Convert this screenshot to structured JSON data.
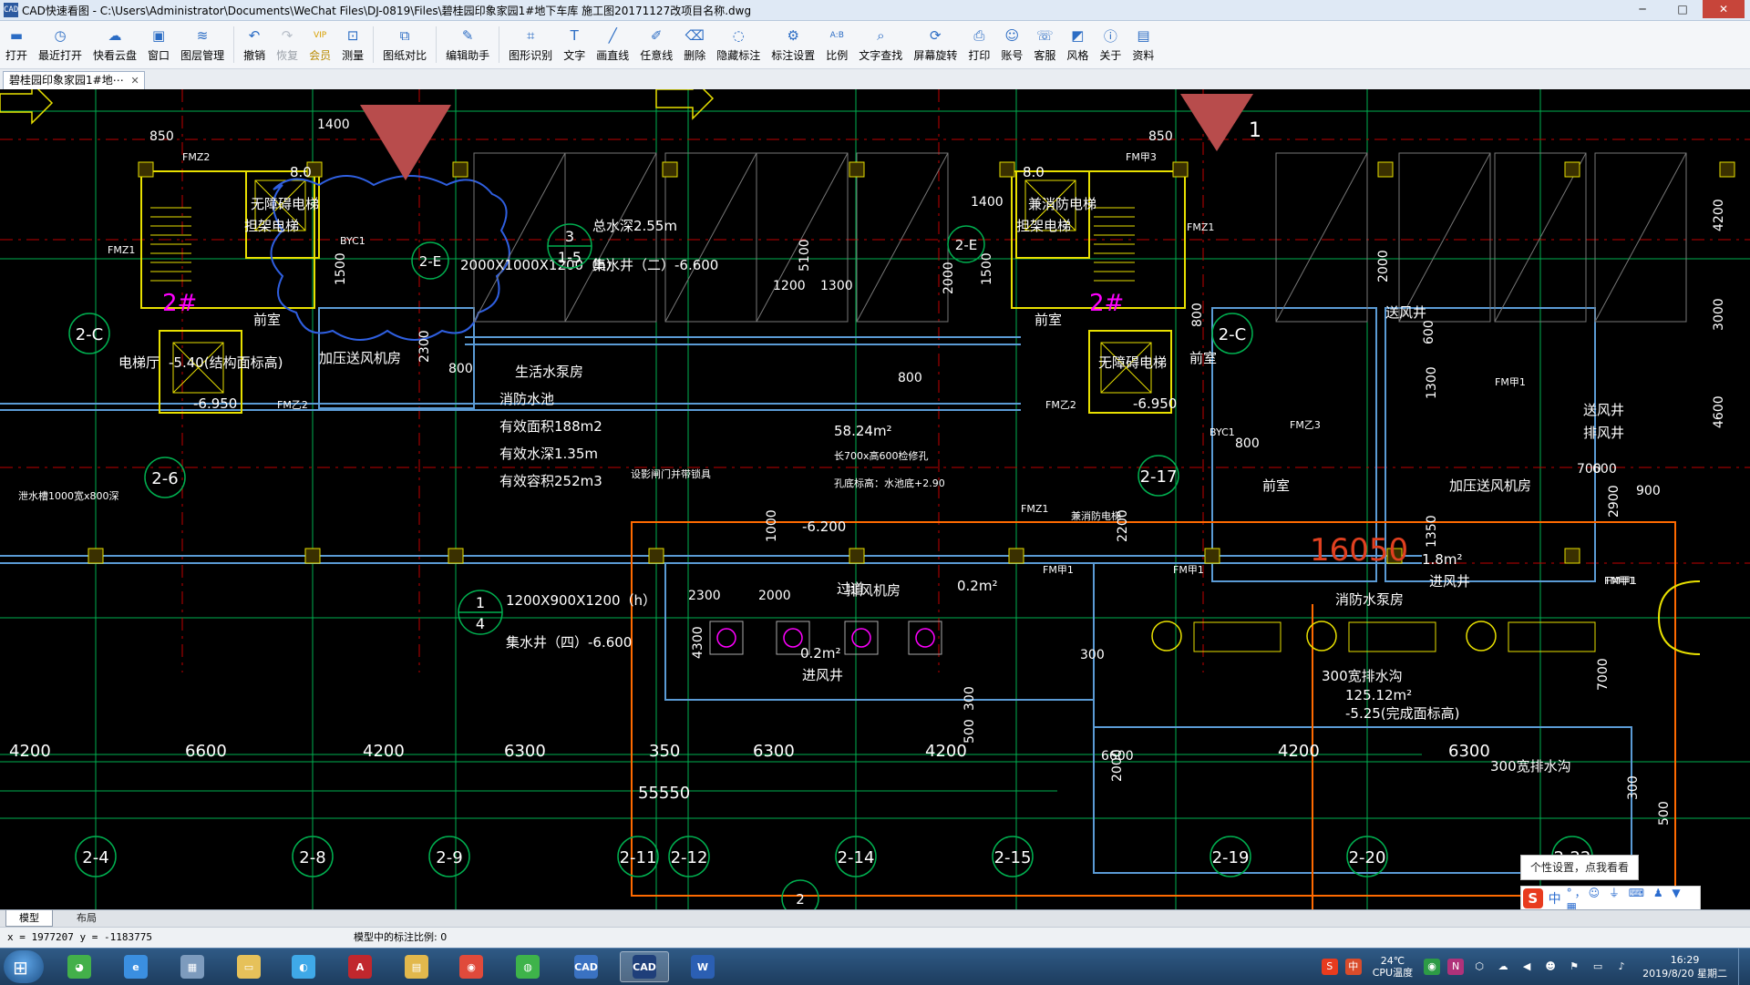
{
  "window": {
    "icon_text": "CAD",
    "title": "CAD快速看图 - C:\\Users\\Administrator\\Documents\\WeChat Files\\DJ-0819\\Files\\碧桂园印象家园1#地下车库 施工图20171127改项目名称.dwg",
    "minimize": "─",
    "maximize": "□",
    "close": "✕"
  },
  "toolbar": [
    {
      "label": "打开",
      "icon": "folder-open-icon",
      "glyph": "▬"
    },
    {
      "label": "最近打开",
      "icon": "clock-icon",
      "glyph": "◷"
    },
    {
      "label": "快看云盘",
      "icon": "cloud-icon",
      "glyph": "☁"
    },
    {
      "label": "窗口",
      "icon": "window-icon",
      "glyph": "▣"
    },
    {
      "label": "图层管理",
      "icon": "layers-icon",
      "glyph": "≋"
    },
    {
      "label": "撤销",
      "icon": "undo-icon",
      "glyph": "↶"
    },
    {
      "label": "恢复",
      "icon": "redo-icon",
      "glyph": "↷",
      "disabled": true
    },
    {
      "label": "会员",
      "icon": "vip-icon",
      "glyph": "VIP",
      "vip": true
    },
    {
      "label": "测量",
      "icon": "measure-icon",
      "glyph": "⊡"
    },
    {
      "label": "图纸对比",
      "icon": "compare-icon",
      "glyph": "⧉"
    },
    {
      "label": "编辑助手",
      "icon": "edit-assistant-icon",
      "glyph": "✎"
    },
    {
      "label": "图形识别",
      "icon": "shape-recognition-icon",
      "glyph": "⌗"
    },
    {
      "label": "文字",
      "icon": "text-icon",
      "glyph": "T"
    },
    {
      "label": "画直线",
      "icon": "line-icon",
      "glyph": "╱"
    },
    {
      "label": "任意线",
      "icon": "freehand-icon",
      "glyph": "✐"
    },
    {
      "label": "删除",
      "icon": "eraser-icon",
      "glyph": "⌫"
    },
    {
      "label": "隐藏标注",
      "icon": "hide-annotation-icon",
      "glyph": "◌"
    },
    {
      "label": "标注设置",
      "icon": "annotation-settings-icon",
      "glyph": "⚙"
    },
    {
      "label": "比例",
      "icon": "scale-icon",
      "glyph": "A:B"
    },
    {
      "label": "文字查找",
      "icon": "text-search-icon",
      "glyph": "⌕"
    },
    {
      "label": "屏幕旋转",
      "icon": "rotate-screen-icon",
      "glyph": "⟳"
    },
    {
      "label": "打印",
      "icon": "print-icon",
      "glyph": "⎙"
    },
    {
      "label": "账号",
      "icon": "account-icon",
      "glyph": "☺"
    },
    {
      "label": "客服",
      "icon": "headset-icon",
      "glyph": "☏"
    },
    {
      "label": "风格",
      "icon": "style-icon",
      "glyph": "◩"
    },
    {
      "label": "关于",
      "icon": "info-icon",
      "glyph": "ⓘ"
    },
    {
      "label": "资料",
      "icon": "documents-icon",
      "glyph": "▤"
    }
  ],
  "doc_tab": {
    "label": "碧桂园印象家园1#地⋯",
    "close": "✕"
  },
  "drawing": {
    "labels_white": [
      "电梯厅",
      "前室",
      "加压送风机房",
      "前室",
      "前室",
      "前室",
      "加压送风机房",
      "排风机房",
      "消防水泵房",
      "生活水泵房",
      "消防水池",
      "有效面积188m2",
      "有效水深1.35m",
      "有效容积252m3",
      "总水深2.55m",
      "集水井（二）-6.600",
      "1200X900X1200（h）",
      "集水井（四）-6.600",
      "2000X1000X1200（h）",
      "送风井",
      "送风井",
      "排风井",
      "1.8m²",
      "进风井",
      "0.2m²",
      "进风井",
      "0.2m²",
      "300宽排水沟",
      "300宽排水沟",
      "125.12m²",
      "-5.25(完成面标高)",
      "-5.40(结构面标高)",
      "无障碍电梯",
      "无障碍电梯",
      "担架电梯",
      "兼消防电梯",
      "担架电梯",
      "兼消防电梯",
      "过道",
      "58.24m²",
      "长700x高600检修孔",
      "孔底标高：水池底+2.90",
      "设影闸门并带锁具",
      "泄水槽1000宽x800深"
    ],
    "elevations": [
      "-6.950",
      "-6.950",
      "-6.200",
      "8.0",
      "8.0"
    ],
    "dims": [
      "850",
      "1400",
      "850",
      "1400",
      "2300",
      "1500",
      "800",
      "2000",
      "1500",
      "800",
      "800",
      "5100",
      "1200",
      "1300",
      "2000",
      "600",
      "700",
      "1300",
      "600",
      "900",
      "800",
      "1350",
      "2900",
      "2200",
      "2300",
      "2000",
      "4300",
      "300",
      "500",
      "300",
      "6600",
      "2000",
      "7000",
      "300",
      "500",
      "4200",
      "3000",
      "4600",
      "1000"
    ],
    "door_tags": [
      "FMZ2",
      "FMZ1",
      "FM乙2",
      "FM乙2",
      "FMZ1",
      "FM乙3",
      "FMZ1",
      "FM甲1",
      "FM甲1",
      "FM甲1",
      "FM甲3",
      "FM甲1",
      "BYC1",
      "BYC1",
      "FM甲1"
    ],
    "axis_dims": [
      "4200",
      "6600",
      "4200",
      "6300",
      "350",
      "6300",
      "4200",
      "4200",
      "6300"
    ],
    "total_dim": "55550",
    "big_dim": "16050",
    "grid_bubbles": [
      "2-4",
      "2-8",
      "2-9",
      "2-11",
      "2-12",
      "2-14",
      "2-15",
      "2-19",
      "2-20",
      "2-22"
    ],
    "side_bubbles": [
      "2-C",
      "2-C",
      "2-6",
      "2-17"
    ],
    "split_bubbles": [
      {
        "top": "3",
        "bottom": "1-5"
      },
      {
        "top": "1",
        "bottom": "4"
      }
    ],
    "other_bubbles": [
      "2-E",
      "2-E",
      "2"
    ],
    "stair_marks": [
      "2#",
      "2#"
    ],
    "marker_numbers": [
      "1"
    ]
  },
  "tooltip": "个性设置，点我看看",
  "ime": {
    "logo": "S",
    "mode": "中",
    "tools": "°，☺ ⏚ ⌨ ♟ ▼ ▦"
  },
  "model_tabs": {
    "model": "模型",
    "layout": "布局"
  },
  "status": {
    "coords": "x = 1977207  y = -1183775",
    "scale": "模型中的标注比例: 0"
  },
  "taskbar": {
    "apps": [
      {
        "name": "browser-360-icon",
        "glyph": "◕",
        "color": "#43b04a"
      },
      {
        "name": "internet-explorer-icon",
        "glyph": "e",
        "color": "#3b8fe0"
      },
      {
        "name": "calculator-icon",
        "glyph": "▦",
        "color": "#7d9bbd"
      },
      {
        "name": "folder-icon",
        "glyph": "▭",
        "color": "#e6c15a"
      },
      {
        "name": "qq-browser-icon",
        "glyph": "◐",
        "color": "#3fa9e8"
      },
      {
        "name": "acrobat-icon",
        "glyph": "A",
        "color": "#c1272d"
      },
      {
        "name": "explorer-icon",
        "glyph": "▤",
        "color": "#e2b84c"
      },
      {
        "name": "chrome-icon",
        "glyph": "◉",
        "color": "#e04a3b"
      },
      {
        "name": "wechat-icon",
        "glyph": "◍",
        "color": "#3eb34a"
      },
      {
        "name": "cad-viewer-icon",
        "glyph": "CAD",
        "color": "#3a72c2"
      },
      {
        "name": "cad-viewer-active-icon",
        "glyph": "CAD",
        "color": "#1f3f7a",
        "active": true
      },
      {
        "name": "word-icon",
        "glyph": "W",
        "color": "#2b5fb3"
      }
    ],
    "temp": "24℃",
    "cpu": "CPU温度",
    "time": "16:29",
    "date": "2019/8/20 星期二"
  }
}
